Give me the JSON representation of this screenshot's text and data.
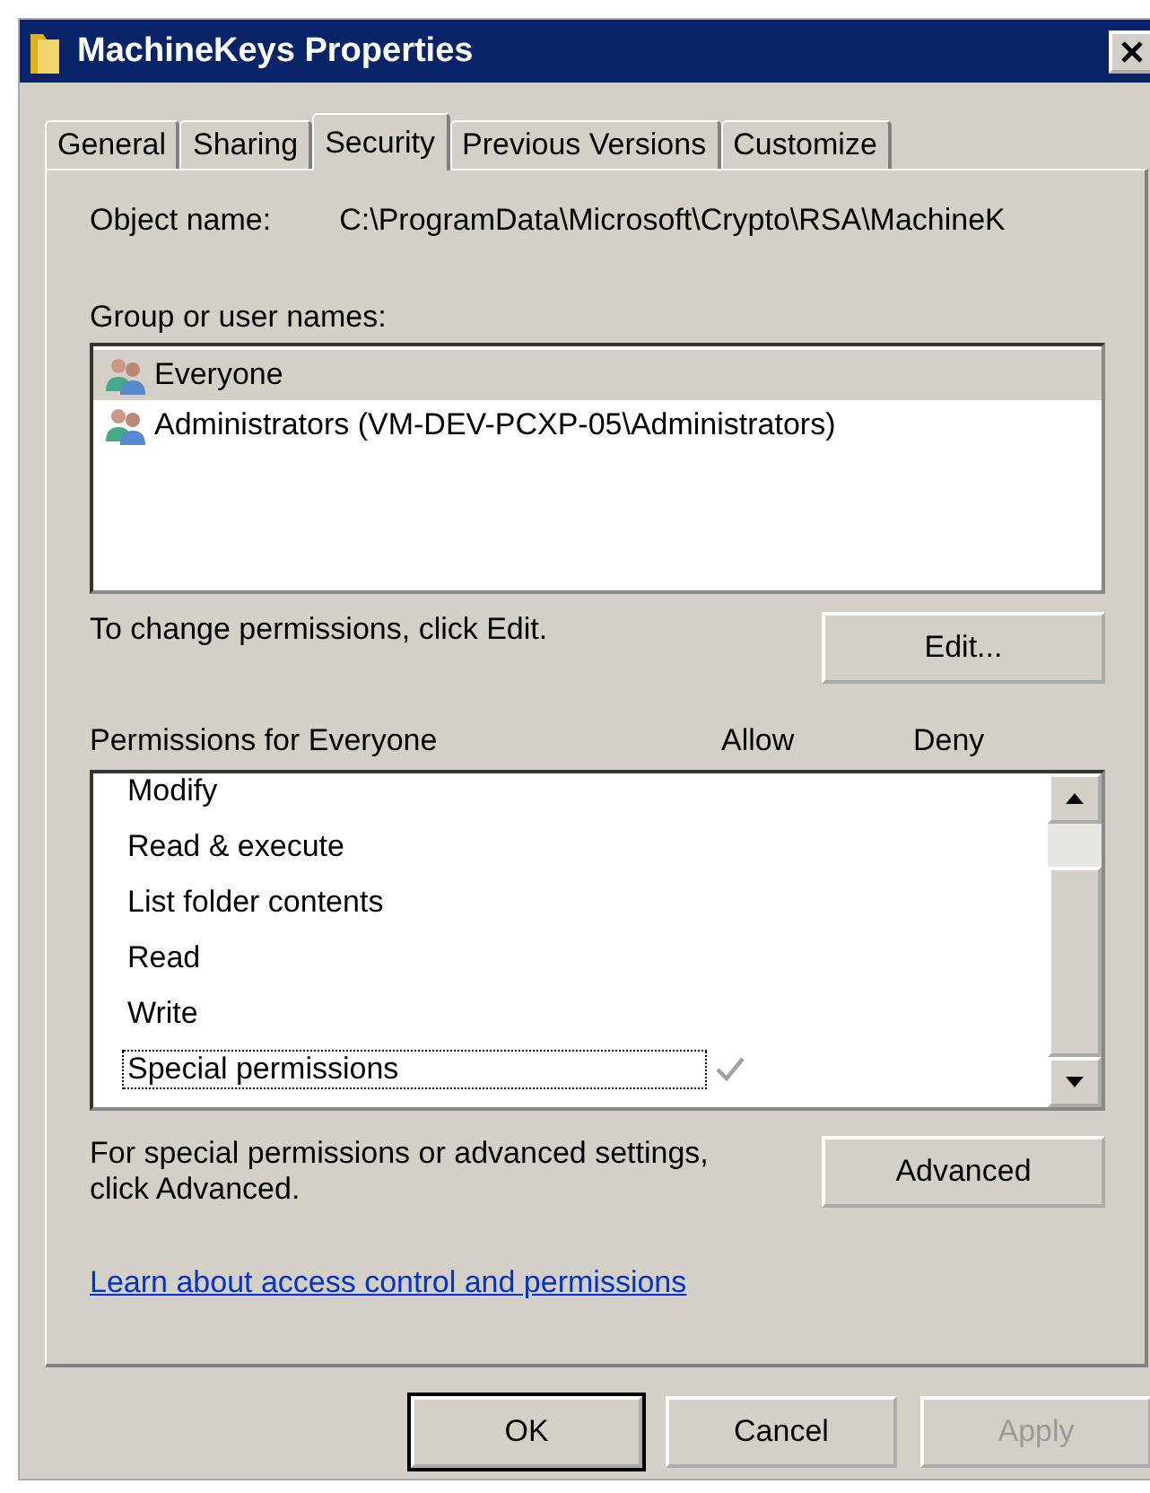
{
  "window": {
    "title": "MachineKeys Properties"
  },
  "tabs": [
    {
      "label": "General",
      "selected": false
    },
    {
      "label": "Sharing",
      "selected": false
    },
    {
      "label": "Security",
      "selected": true
    },
    {
      "label": "Previous Versions",
      "selected": false
    },
    {
      "label": "Customize",
      "selected": false
    }
  ],
  "object_name": {
    "label": "Object name:",
    "value": "C:\\ProgramData\\Microsoft\\Crypto\\RSA\\MachineK"
  },
  "groups": {
    "label": "Group or user names:",
    "items": [
      {
        "name": "Everyone",
        "selected": true
      },
      {
        "name": "Administrators (VM-DEV-PCXP-05\\Administrators)",
        "selected": false
      }
    ]
  },
  "change_hint": "To change permissions, click Edit.",
  "edit_button": "Edit...",
  "permissions": {
    "label": "Permissions for Everyone",
    "allow_header": "Allow",
    "deny_header": "Deny",
    "rows": [
      {
        "name": "Modify",
        "allow": false,
        "deny": false,
        "focused": false
      },
      {
        "name": "Read & execute",
        "allow": false,
        "deny": false,
        "focused": false
      },
      {
        "name": "List folder contents",
        "allow": false,
        "deny": false,
        "focused": false
      },
      {
        "name": "Read",
        "allow": false,
        "deny": false,
        "focused": false
      },
      {
        "name": "Write",
        "allow": false,
        "deny": false,
        "focused": false
      },
      {
        "name": "Special permissions",
        "allow": true,
        "deny": false,
        "focused": true
      }
    ]
  },
  "advanced_hint": "For special permissions or advanced settings, click Advanced.",
  "advanced_button": "Advanced",
  "link": "Learn about access control and permissions",
  "buttons": [
    {
      "label": "OK",
      "default": true,
      "disabled": false
    },
    {
      "label": "Cancel",
      "default": false,
      "disabled": false
    },
    {
      "label": "Apply",
      "default": false,
      "disabled": true
    }
  ]
}
